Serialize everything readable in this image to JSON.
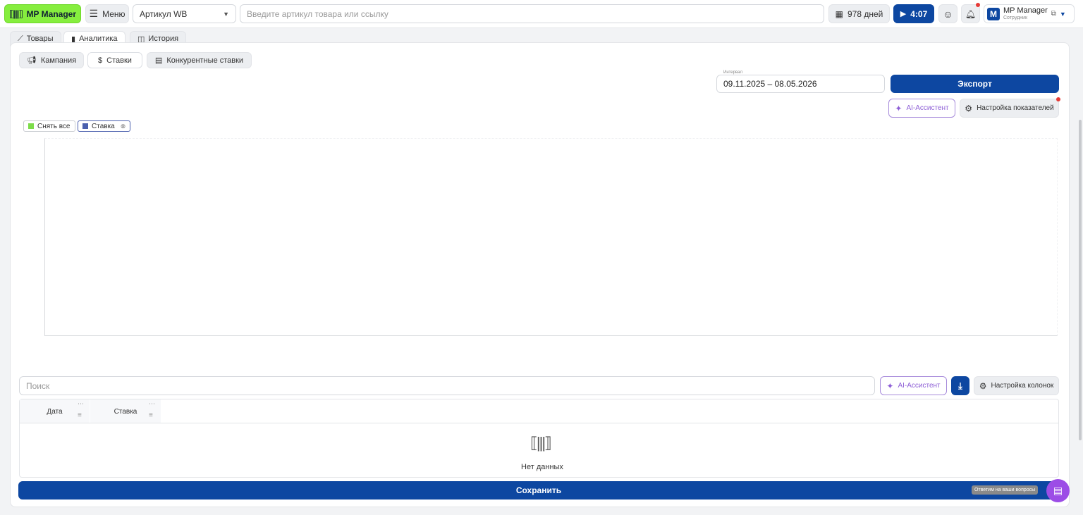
{
  "header": {
    "brand": "MP Manager",
    "menu_label": "Меню",
    "article_select": "Артикул WB",
    "search_placeholder": "Введите артикул товара или ссылку",
    "days_label": "978 дней",
    "timer_label": "4:07",
    "user_name": "MP Manager",
    "user_role": "Сотрудник",
    "avatar_letter": "M"
  },
  "tabs": [
    {
      "label": "Товары"
    },
    {
      "label": "Аналитика"
    },
    {
      "label": "История"
    }
  ],
  "subtabs": [
    {
      "label": "Кампания"
    },
    {
      "label": "Ставки"
    },
    {
      "label": "Конкурентные ставки"
    }
  ],
  "interval": {
    "label": "Интервал",
    "value": "09.11.2025 – 08.05.2026"
  },
  "export_label": "Экспорт",
  "ai_label": "AI-Ассистент",
  "metrics_settings_label": "Настройка показателей",
  "chips": [
    {
      "label": "Снять все",
      "color": "#7ddc4a"
    },
    {
      "label": "Ставка",
      "color": "#4a5fae"
    }
  ],
  "table": {
    "search_placeholder": "Поиск",
    "ai_label": "AI-Ассистент",
    "columns_settings_label": "Настройка колонок",
    "columns": [
      "Дата",
      "Ставка"
    ],
    "empty_text": "Нет данных"
  },
  "save_label": "Сохранить",
  "support_tooltip": "Ответим на ваши вопросы",
  "colors": {
    "brand_green": "#86ee3e",
    "primary_blue": "#0d47a1",
    "ai_purple": "#8e5fd6",
    "support_purple": "#9c4de6"
  }
}
